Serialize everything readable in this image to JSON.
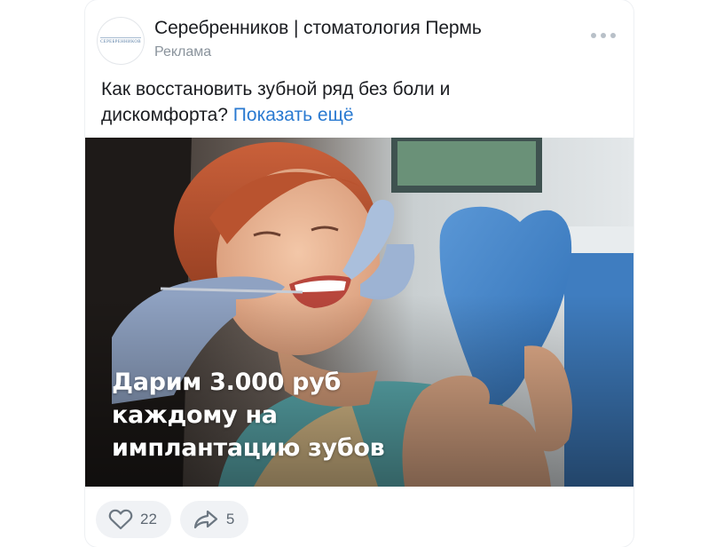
{
  "post": {
    "author": "Серебренников | стоматология Пермь",
    "label": "Реклама",
    "avatar_text": "Серебренников",
    "text_line1": "Как восстановить зубной ряд без боли и",
    "text_line2": "дискомфорта?",
    "show_more": "Показать ещё",
    "image": {
      "promo_line1": "Дарим 3.000 руб",
      "promo_line2": "каждому на",
      "promo_line3": "имплантацию зубов"
    },
    "actions": {
      "likes_icon": "heart-icon",
      "likes": "22",
      "shares_icon": "share-arrow-icon",
      "shares": "5"
    },
    "colors": {
      "link": "#2a7ad1",
      "text": "#1b1d21",
      "muted": "#8a939c"
    }
  }
}
